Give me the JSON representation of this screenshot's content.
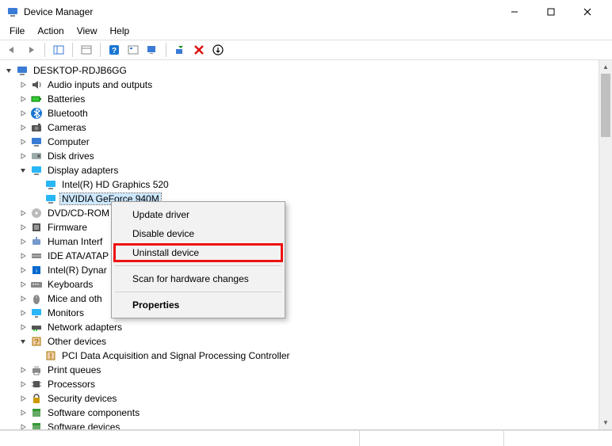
{
  "window": {
    "title": "Device Manager"
  },
  "menubar": {
    "file": "File",
    "action": "Action",
    "view": "View",
    "help": "Help"
  },
  "tree": {
    "root": "DESKTOP-RDJB6GG",
    "items": [
      {
        "label": "Audio inputs and outputs",
        "icon": "audio"
      },
      {
        "label": "Batteries",
        "icon": "battery"
      },
      {
        "label": "Bluetooth",
        "icon": "bluetooth"
      },
      {
        "label": "Cameras",
        "icon": "camera"
      },
      {
        "label": "Computer",
        "icon": "computer"
      },
      {
        "label": "Disk drives",
        "icon": "disk"
      },
      {
        "label": "Display adapters",
        "icon": "display",
        "expanded": true,
        "children": [
          {
            "label": "Intel(R) HD Graphics 520",
            "icon": "display"
          },
          {
            "label": "NVIDIA GeForce 940M",
            "icon": "display",
            "selected": true
          }
        ]
      },
      {
        "label": "DVD/CD-ROM",
        "icon": "dvd",
        "truncated": true
      },
      {
        "label": "Firmware",
        "icon": "firmware"
      },
      {
        "label": "Human Interf",
        "icon": "hid",
        "truncated": true
      },
      {
        "label": "IDE ATA/ATAP",
        "icon": "ide",
        "truncated": true
      },
      {
        "label": "Intel(R) Dynar",
        "icon": "intel",
        "truncated": true
      },
      {
        "label": "Keyboards",
        "icon": "keyboard"
      },
      {
        "label": "Mice and oth",
        "icon": "mouse",
        "truncated": true
      },
      {
        "label": "Monitors",
        "icon": "monitor"
      },
      {
        "label": "Network adapters",
        "icon": "network"
      },
      {
        "label": "Other devices",
        "icon": "other",
        "expanded": true,
        "children": [
          {
            "label": "PCI Data Acquisition and Signal Processing Controller",
            "icon": "warn"
          }
        ]
      },
      {
        "label": "Print queues",
        "icon": "printer"
      },
      {
        "label": "Processors",
        "icon": "cpu"
      },
      {
        "label": "Security devices",
        "icon": "security"
      },
      {
        "label": "Software components",
        "icon": "software"
      },
      {
        "label": "Software devices",
        "icon": "software"
      }
    ]
  },
  "context_menu": {
    "update": "Update driver",
    "disable": "Disable device",
    "uninstall": "Uninstall device",
    "scan": "Scan for hardware changes",
    "properties": "Properties"
  }
}
